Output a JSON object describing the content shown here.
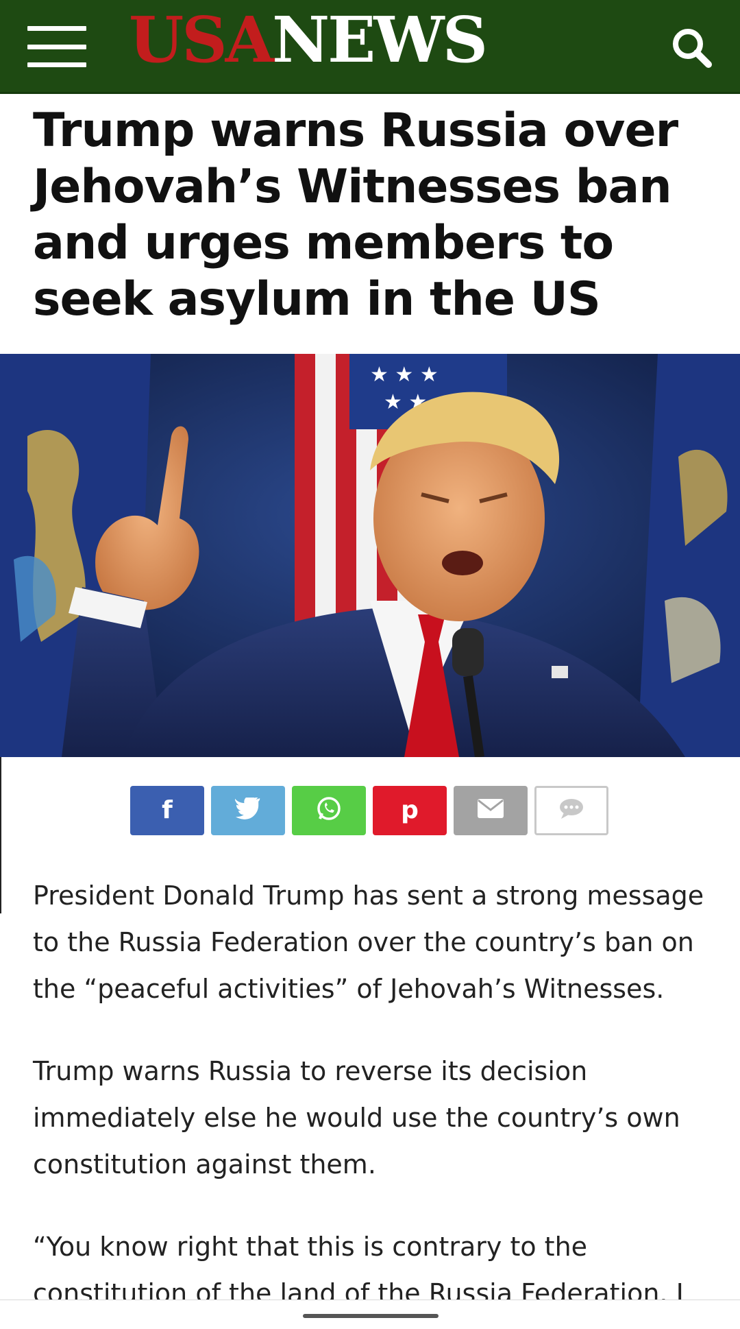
{
  "header": {
    "logo_usa": "USA",
    "logo_news": "NEWS",
    "menu_icon": "hamburger-menu-icon",
    "search_icon": "search-icon",
    "background_color": "#1e4a12",
    "logo_red": "#c21d1d"
  },
  "article": {
    "headline": "Trump warns Russia over Jehovah’s Witnesses ban and urges members to seek asylum in the US",
    "paragraphs": [
      "President Donald Trump has sent a strong message to the Russia Federation over the country’s ban on the “peaceful activities” of Jehovah’s Witnesses.",
      "Trump warns Russia to reverse its decision immediately else he would use the country’s own constitution against them.",
      "“You know right that this is contrary to the constitution of the land of the Russia Federation. I"
    ]
  },
  "share": {
    "buttons": [
      {
        "name": "facebook",
        "glyph": "f",
        "icon": "facebook-icon",
        "color": "#3b5fb0"
      },
      {
        "name": "twitter",
        "glyph": "🐦",
        "icon": "twitter-icon",
        "color": "#62acd9"
      },
      {
        "name": "whatsapp",
        "glyph": "✆",
        "icon": "whatsapp-icon",
        "color": "#57cd46"
      },
      {
        "name": "pinterest",
        "glyph": "p",
        "icon": "pinterest-icon",
        "color": "#e01a2b"
      },
      {
        "name": "email",
        "glyph": "✉",
        "icon": "email-icon",
        "color": "#a3a3a3"
      },
      {
        "name": "comment",
        "glyph": "💬",
        "icon": "comment-icon",
        "color": "#ffffff"
      }
    ]
  }
}
